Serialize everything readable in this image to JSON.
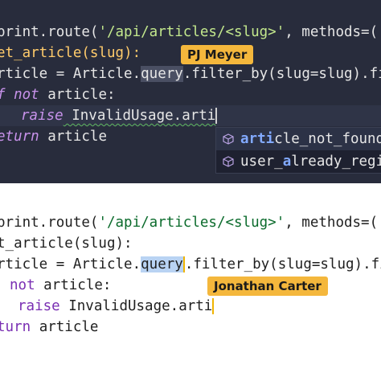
{
  "dark_panel": {
    "lines": [
      {
        "text_a": "print.route(",
        "str": "'/api/articles/<slug>'",
        "text_b": ", methods=("
      },
      {
        "text_a": "et_article(slug):"
      },
      {
        "text_a": "rticle = Article.",
        "sel": "query",
        "text_b": ".filter_by(slug=slug).fi"
      },
      {
        "kw": "f not",
        "text_a": " article:"
      },
      {
        "kw": "raise",
        "text_a": " InvalidUsage.arti"
      },
      {
        "kw": "eturn",
        "text_a": " article"
      }
    ],
    "user_tag": "PJ Meyer",
    "autocomplete": [
      {
        "match": "arti",
        "rest": "cle_not_found",
        "icon": "cube-icon"
      },
      {
        "pre": "user_",
        "match": "a",
        "rest": "lready_regi",
        "icon": "cube-icon"
      }
    ]
  },
  "light_panel": {
    "lines": [
      {
        "text_a": "print.route(",
        "str": "'/api/articles/<slug>'",
        "text_b": ", methods=('G"
      },
      {
        "text_a": "t_article(slug):"
      },
      {
        "text_a": "rticle = Article.",
        "sel": "query",
        "text_b": ".filter_by(slug=slug).fir"
      },
      {
        "kw": "not",
        "text_a": " article:"
      },
      {
        "kw": "raise",
        "text_a": " InvalidUsage.arti"
      },
      {
        "kw": "turn",
        "text_a": " article"
      }
    ],
    "user_tag": "Jonathan Carter"
  }
}
